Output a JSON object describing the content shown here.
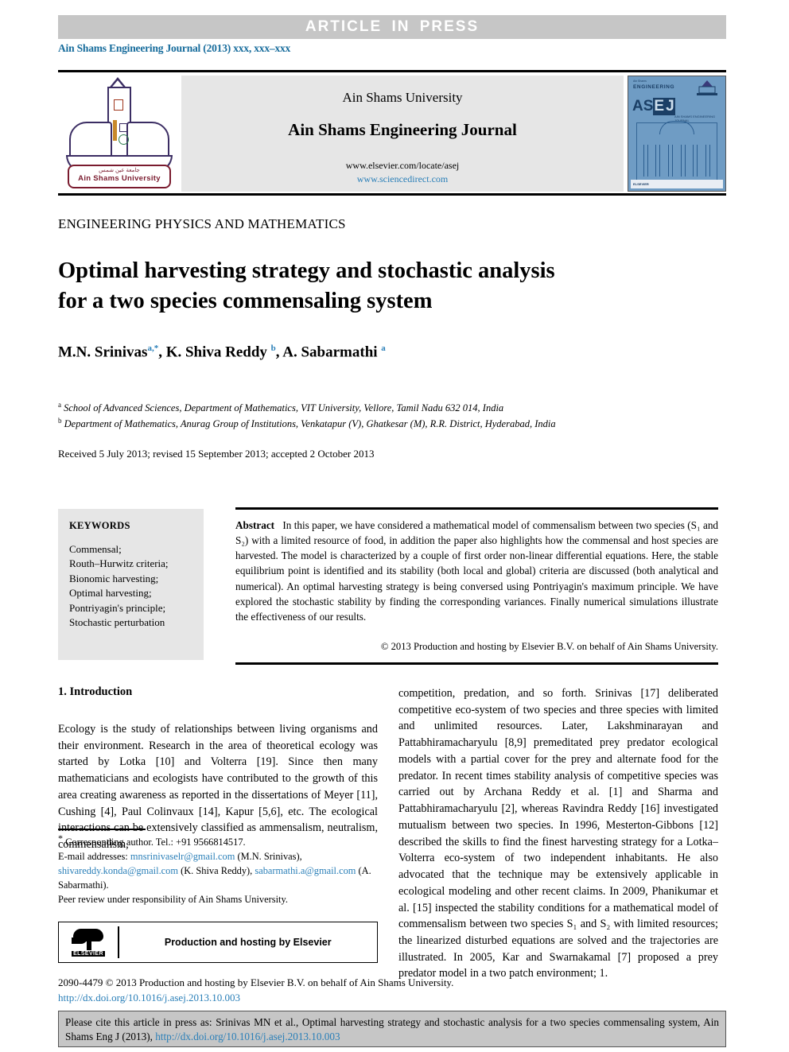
{
  "banner": {
    "text": "ARTICLE  IN  PRESS"
  },
  "running_head": {
    "text": "Ain Shams Engineering Journal (2013) xxx, xxx–xxx"
  },
  "masthead": {
    "university": "Ain Shams University",
    "journal_title": "Ain Shams Engineering Journal",
    "url_elsevier": "www.elsevier.com/locate/asej",
    "url_sciencedirect": "www.sciencedirect.com",
    "logo_caption_arabic": "جامعة عين شمس",
    "logo_caption": "Ain Shams University",
    "cover": {
      "top_label": "ENGINEERING",
      "tiny_label": "Ain Shams",
      "acronym": "ASEJ",
      "subtitle": "AIN SHAMS ENGINEERING JOURNAL",
      "footer_label": "ELSEVIER"
    }
  },
  "article": {
    "section_category": "ENGINEERING PHYSICS AND MATHEMATICS",
    "title_line1": "Optimal harvesting strategy and stochastic analysis",
    "title_line2": "for a two species commensaling system",
    "authors": [
      {
        "name": "M.N. Srinivas",
        "marks": "a,*"
      },
      {
        "name": "K. Shiva Reddy",
        "marks": "b"
      },
      {
        "name": "A. Sabarmathi",
        "marks": "a"
      }
    ],
    "affiliations": [
      {
        "mark": "a",
        "text": "School of Advanced Sciences, Department of Mathematics, VIT University, Vellore, Tamil Nadu 632 014, India"
      },
      {
        "mark": "b",
        "text": "Department of Mathematics, Anurag Group of Institutions, Venkatapur (V), Ghatkesar (M), R.R. District, Hyderabad, India"
      }
    ],
    "history": "Received 5 July 2013; revised 15 September 2013; accepted 2 October 2013"
  },
  "keywords": {
    "heading": "KEYWORDS",
    "items": [
      "Commensal;",
      "Routh–Hurwitz criteria;",
      "Bionomic harvesting;",
      "Optimal harvesting;",
      "Pontriyagin's principle;",
      "Stochastic perturbation"
    ]
  },
  "abstract": {
    "label": "Abstract",
    "text": "In this paper, we have considered a mathematical model of commensalism between two species (S₁ and S₂) with a limited resource of food, in addition the paper also highlights how the commensal and host species are harvested. The model is characterized by a couple of first order non-linear differential equations. Here, the stable equilibrium point is identified and its stability (both local and global) criteria are discussed (both analytical and numerical). An optimal harvesting strategy is being conversed using Pontriyagin's maximum principle. We have explored the stochastic stability by finding the corresponding variances. Finally numerical simulations illustrate the effectiveness of our results.",
    "copyright": "© 2013 Production and hosting by Elsevier B.V. on behalf of Ain Shams University."
  },
  "body": {
    "intro_heading": "1. Introduction",
    "left_paragraph": "Ecology is the study of relationships between living organisms and their environment. Research in the area of theoretical ecology was started by Lotka [10] and Volterra [19]. Since then many mathematicians and ecologists have contributed to the growth of this area creating awareness as reported in the dissertations of Meyer [11], Cushing [4], Paul Colinvaux [14], Kapur [5,6], etc. The ecological interactions can be extensively classified as ammensalism, neutralism, commensalism,",
    "right_paragraph": "competition, predation, and so forth. Srinivas [17] deliberated competitive eco-system of two species and three species with limited and unlimited resources. Later, Lakshminarayan and Pattabhiramacharyulu [8,9] premeditated prey predator ecological models with a partial cover for the prey and alternate food for the predator. In recent times stability analysis of competitive species was carried out by Archana Reddy et al. [1] and Sharma and Pattabhiramacharyulu [2], whereas Ravindra Reddy [16] investigated mutualism between two species. In 1996, Mesterton-Gibbons [12] described the skills to find the finest harvesting strategy for a Lotka–Volterra eco-system of two independent inhabitants. He also advocated that the technique may be extensively applicable in ecological modeling and other recent claims. In 2009, Phanikumar et al. [15] inspected the stability conditions for a mathematical model of commensalism between two species S₁ and S₂ with limited resources; the linearized disturbed equations are solved and the trajectories are illustrated. In 2005, Kar and Swarnakamal [7] proposed a prey predator model in a two patch environment; 1."
  },
  "footnotes": {
    "corresponding": "Corresponding author. Tel.: +91 9566814517.",
    "email_label": "E-mail addresses:",
    "emails": [
      {
        "address": "mnsrinivaselr@gmail.com",
        "owner": "(M.N. Srinivas),"
      },
      {
        "address": "shivareddy.konda@gmail.com",
        "owner": "(K. Shiva Reddy),"
      },
      {
        "address": "sabarmathi.a@gmail.com",
        "owner": "(A. Sabarmathi)."
      }
    ],
    "peer_review": "Peer review under responsibility of Ain Shams University."
  },
  "elsevier_box": {
    "text": "Production and hosting by Elsevier",
    "logo_word": "ELSEVIER"
  },
  "imprint": {
    "issn_line": "2090-4479 © 2013 Production and hosting by Elsevier B.V. on behalf of Ain Shams University.",
    "doi": "http://dx.doi.org/10.1016/j.asej.2013.10.003"
  },
  "cite_box": {
    "prefix": "Please cite this article in press as: Srinivas MN et al., Optimal harvesting strategy and stochastic analysis for a two species commensaling system, Ain Shams Eng J (2013), ",
    "doi": "http://dx.doi.org/10.1016/j.asej.2013.10.003"
  },
  "colors": {
    "link": "#2a7fb8",
    "banner_bg": "#c6c6c6",
    "panel_bg": "#e6e6e6"
  }
}
